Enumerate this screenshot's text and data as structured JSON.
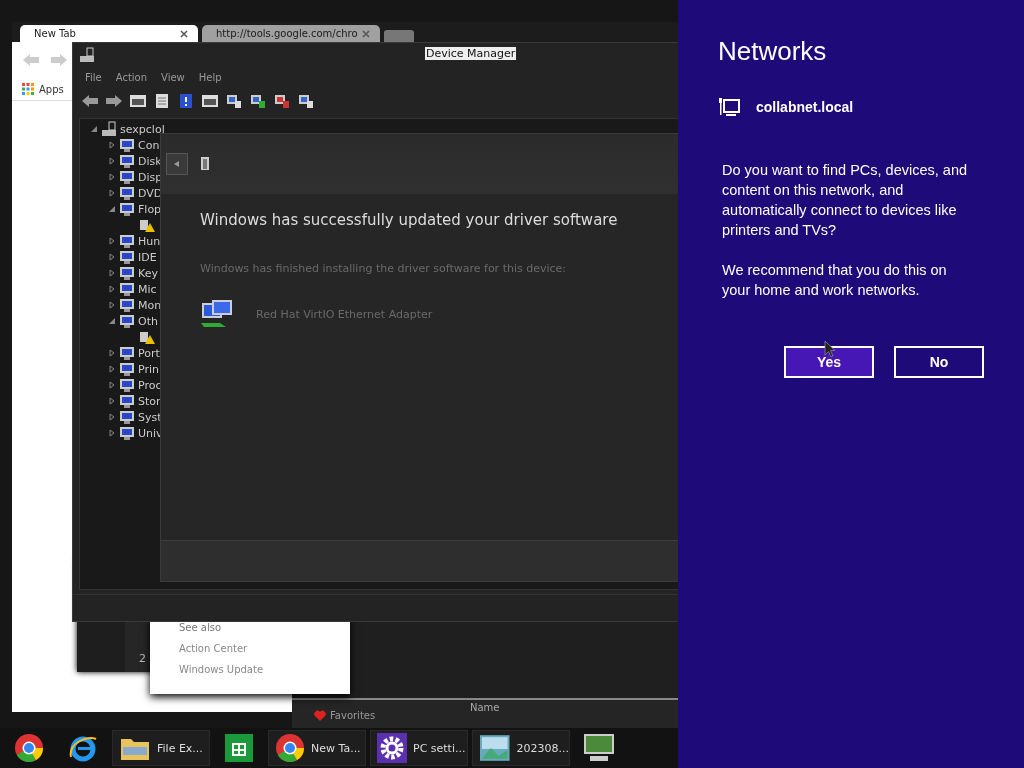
{
  "browser": {
    "tabs": [
      {
        "label": "New Tab",
        "selected": true
      },
      {
        "label": "http://tools.google.com/chro",
        "selected": false
      }
    ],
    "bookmarks": [
      "Apps"
    ]
  },
  "background_windows": {
    "count_text": "2",
    "see_also": {
      "heading": "See also",
      "links": [
        "Action Center",
        "Windows Update"
      ]
    },
    "favorites": "Favorites",
    "column_header": "Name"
  },
  "device_manager": {
    "title": "Device Manager",
    "menu": [
      "File",
      "Action",
      "View",
      "Help"
    ],
    "tree": {
      "label": "sexpclol",
      "expanded": true,
      "children": [
        {
          "label": "Con",
          "expanded": false
        },
        {
          "label": "Disk",
          "expanded": false
        },
        {
          "label": "Disp",
          "expanded": false
        },
        {
          "label": "DVD",
          "expanded": false
        },
        {
          "label": "Flop",
          "expanded": true,
          "children": [
            {
              "kind": "warning"
            }
          ]
        },
        {
          "label": "Hun",
          "expanded": false
        },
        {
          "label": "IDE",
          "expanded": false
        },
        {
          "label": "Key",
          "expanded": false
        },
        {
          "label": "Mic",
          "expanded": false
        },
        {
          "label": "Mon",
          "expanded": false
        },
        {
          "label": "Oth",
          "expanded": true,
          "children": [
            {
              "kind": "warning"
            }
          ]
        },
        {
          "label": "Port",
          "expanded": false
        },
        {
          "label": "Prin",
          "expanded": false
        },
        {
          "label": "Proc",
          "expanded": false
        },
        {
          "label": "Stor",
          "expanded": false
        },
        {
          "label": "Syst",
          "expanded": false
        },
        {
          "label": "Univ",
          "expanded": false
        }
      ]
    }
  },
  "driver_dialog": {
    "heading": "Windows has successfully updated your driver software",
    "message": "Windows has finished installing the driver software for this device:",
    "device": "Red Hat VirtIO Ethernet Adapter"
  },
  "taskbar": [
    {
      "kind": "pinned"
    },
    {
      "kind": "pinned"
    },
    {
      "kind": "window",
      "label": "File Ex..."
    },
    {
      "kind": "pinned"
    },
    {
      "kind": "window",
      "label": "New Ta..."
    },
    {
      "kind": "window",
      "label": "PC setti..."
    },
    {
      "kind": "window",
      "label": "202308..."
    },
    {
      "kind": "pinned"
    }
  ],
  "networks_panel": {
    "title": "Networks",
    "network": "collabnet.local",
    "question": "Do you want to find PCs, devices, and content on this network, and automatically connect to devices like printers and TVs?",
    "recommendation": "We recommend that you do this on your home and work networks.",
    "buttons": [
      {
        "label": "Yes",
        "selected": true
      },
      {
        "label": "No",
        "selected": false
      }
    ]
  }
}
